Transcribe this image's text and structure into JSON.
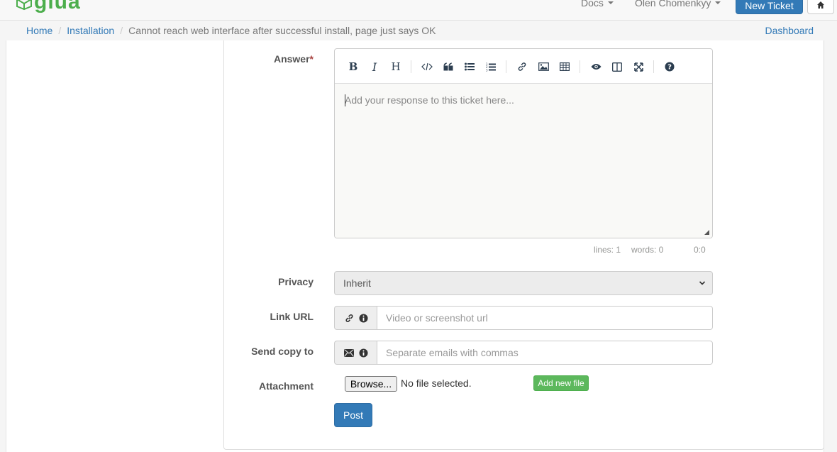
{
  "navbar": {
    "logo_text": "glua",
    "docs_label": "Docs",
    "user_label": "Olen Chomenkyy",
    "new_ticket_label": "New Ticket",
    "home_icon": "home-icon"
  },
  "breadcrumb": {
    "items": [
      "Home",
      "Installation"
    ],
    "current": "Cannot reach web interface after successful install, page just says OK",
    "dashboard_label": "Dashboard"
  },
  "form": {
    "answer_label": "Answer",
    "required_mark": "*",
    "editor": {
      "placeholder": "Add your response to this ticket here...",
      "toolbar": [
        "bold-icon",
        "italic-icon",
        "heading-icon",
        "code-icon",
        "quote-icon",
        "unordered-list-icon",
        "ordered-list-icon",
        "link-icon",
        "image-icon",
        "table-icon",
        "preview-icon",
        "side-by-side-icon",
        "fullscreen-icon",
        "guide-icon"
      ],
      "status_lines": "lines: 1",
      "status_words": "words: 0",
      "status_cursor": "0:0"
    },
    "privacy_label": "Privacy",
    "privacy_value": "Inherit",
    "link_url_label": "Link URL",
    "link_url_placeholder": "Video or screenshot url",
    "send_copy_label": "Send copy to",
    "send_copy_placeholder": "Separate emails with commas",
    "attachment_label": "Attachment",
    "browse_label": "Browse...",
    "no_file_label": "No file selected.",
    "add_file_label": "Add new file",
    "post_label": "Post"
  },
  "colors": {
    "primary": "#337ab7",
    "success": "#5cb85c",
    "required": "#a94442"
  }
}
